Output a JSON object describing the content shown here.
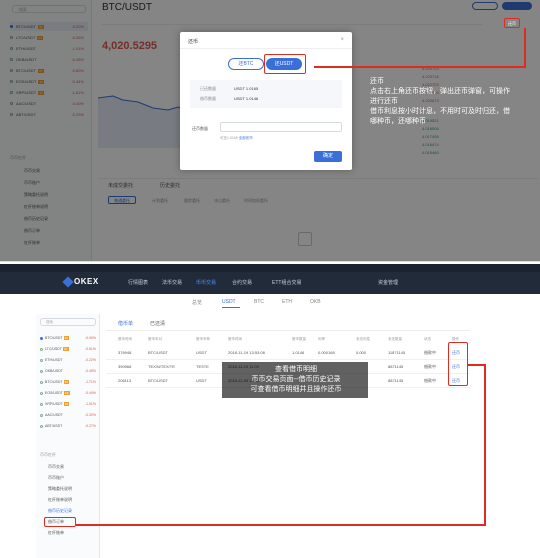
{
  "top": {
    "pair_title": "BTC/USDT",
    "price": "4,020.5295",
    "modal": {
      "title": "还币",
      "close": "×",
      "tab_btc": "还BTC",
      "tab_usdt": "还USDT",
      "label_borrowed": "已还数量",
      "label_interest": "借币数量",
      "val_borrowed": "USDT 1.0165",
      "val_interest": "USDT 1.0146",
      "label_amount": "还币数量",
      "hint_prefix": "可还1.0165",
      "hint_link": "全部还币",
      "confirm": "确定"
    },
    "sidebar": {
      "search_placeholder": "搜索",
      "coins": [
        {
          "name": "BTC/USDT",
          "tag": "3X",
          "change": "-0.20%",
          "selected": true
        },
        {
          "name": "LTC/USDT",
          "tag": "3X",
          "change": "-0.26%"
        },
        {
          "name": "ETH/USDT",
          "tag": "",
          "change": "-1.01%"
        },
        {
          "name": "OKB/USDT",
          "tag": "",
          "change": "-0.45%"
        },
        {
          "name": "BTC/USDT",
          "tag": "3X",
          "change": "-0.80%"
        },
        {
          "name": "EOS/USDT",
          "tag": "3X",
          "change": "-0.44%"
        },
        {
          "name": "XRP/USDT",
          "tag": "3X",
          "change": "-1.61%"
        },
        {
          "name": "AAC/USDT",
          "tag": "",
          "change": "-0.40%"
        },
        {
          "name": "ABT/USDT",
          "tag": "",
          "change": "-0.23%"
        }
      ],
      "menu_title": "币币杠杆",
      "menu": [
        "币币交易",
        "币币账户",
        "策略委托说明",
        "杠杆账单说明",
        "借币历史记录",
        "借币订单",
        "杠杆账单"
      ]
    },
    "order_tabs": [
      "未成交委托",
      "历史委托"
    ],
    "order_filters": [
      "普通委托",
      "计划委托",
      "跟踪委托",
      "冰山委托",
      "时间加权委托"
    ],
    "annotation": [
      "还币",
      "点击右上角还币按钮，弹出还币弹窗，可操作",
      "进行还币",
      "借币利息按小时计息，不用时可及时归还，借",
      "哪种币，还哪种币"
    ],
    "header_button": "还币"
  },
  "bottom": {
    "logo": "OKEX",
    "nav": [
      "行情图表",
      "法币交易",
      "币币交易",
      "合约交易",
      "ETT组合交易"
    ],
    "nav_active": 2,
    "asset_label": "资金管理",
    "subtabs": [
      "总览",
      "USDT",
      "BTC",
      "ETH",
      "OKB"
    ],
    "subtab_active": 1,
    "list_tabs": [
      "借币单",
      "已还清"
    ],
    "headers": [
      "借币时间",
      "借币币对",
      "借币币种",
      "借币时间",
      "借币数量",
      "利率",
      "未还利息",
      "未还数量",
      "状态",
      "操作"
    ],
    "rows": [
      [
        "376948",
        "BTC/USDT",
        "USDT",
        "2018-11-19 13:53:08",
        "1.0146",
        "0.000168",
        "0.000",
        "11871145",
        "借款中",
        "还币"
      ],
      [
        "390968",
        "TEX/N/TEX/TE",
        "TESTE",
        "2018-11-19 11:00",
        "",
        "",
        "",
        "8871145",
        "借款中",
        "还币"
      ],
      [
        "206113",
        "BTC/USDT",
        "USDT",
        "2018-11-09 13:53",
        "",
        "",
        "",
        "8871145",
        "借款中",
        "还币"
      ]
    ],
    "sidebar": {
      "search_placeholder": "搜索",
      "coins": [
        {
          "name": "BTC/USDT",
          "tag": "3X",
          "change": "-0.90%",
          "selected": true
        },
        {
          "name": "LTC/USDT",
          "tag": "3X",
          "change": "-0.61%"
        },
        {
          "name": "ETH/USDT",
          "tag": "",
          "change": "-0.22%"
        },
        {
          "name": "OKB/USDT",
          "tag": "",
          "change": "-0.45%"
        },
        {
          "name": "BTC/USDT",
          "tag": "3X",
          "change": "-1.71%"
        },
        {
          "name": "EOS/USDT",
          "tag": "3X",
          "change": "-0.44%"
        },
        {
          "name": "XRP/USDT",
          "tag": "3X",
          "change": "-1.51%"
        },
        {
          "name": "AAC/USDT",
          "tag": "",
          "change": "-0.32%"
        },
        {
          "name": "ABT/USDT",
          "tag": "",
          "change": "-0.27%"
        }
      ],
      "menu_title": "币币杠杆",
      "menu": [
        "币币交易",
        "币币账户",
        "策略委托说明",
        "杠杆账单说明",
        "借币历史记录",
        "借币订单",
        "杠杆账单"
      ],
      "menu_selected": 4
    },
    "annotation": [
      "查看借币明细",
      "币币交易页面--借币历史记录",
      "可查看借币明细并且操作还币"
    ]
  },
  "colors": {
    "accent": "#3a6fd8",
    "annotation_red": "#e02b20",
    "down": "#e05a4f"
  }
}
